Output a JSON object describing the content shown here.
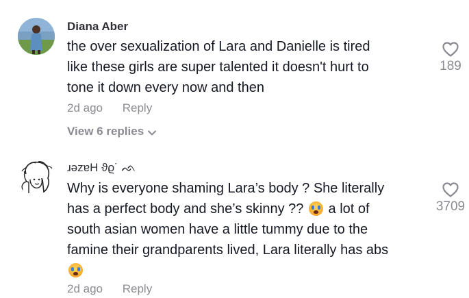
{
  "comments": [
    {
      "username": "Diana Aber",
      "lines": [
        "the over sexualization of Lara and Danielle is tired",
        "like these girls are super talented it doesn't hurt to",
        "tone it down every now and then"
      ],
      "age": "2d ago",
      "reply_label": "Reply",
      "view_replies": "View 6 replies",
      "likes": "189",
      "avatar_icon": "user-photo-avatar"
    },
    {
      "username": "ɹǝzɐH ϑϱ˙ ᨒ",
      "line1": "Why is everyone shaming Lara’s body ? She literally",
      "line2_a": "has a perfect body and she’s skinny ??",
      "line2_b": " a lot of",
      "line3": "south asian women have a little tummy due to the",
      "line4": "famine their grandparents lived, Lara literally has abs",
      "age": "2d ago",
      "reply_label": "Reply",
      "likes": "3709",
      "emoji_icon": "crying-face-emoji",
      "avatar_icon": "sketch-drawing-avatar"
    }
  ],
  "colors": {
    "text": "#161823",
    "muted": "#8a8b91",
    "username": "#2f3037"
  }
}
